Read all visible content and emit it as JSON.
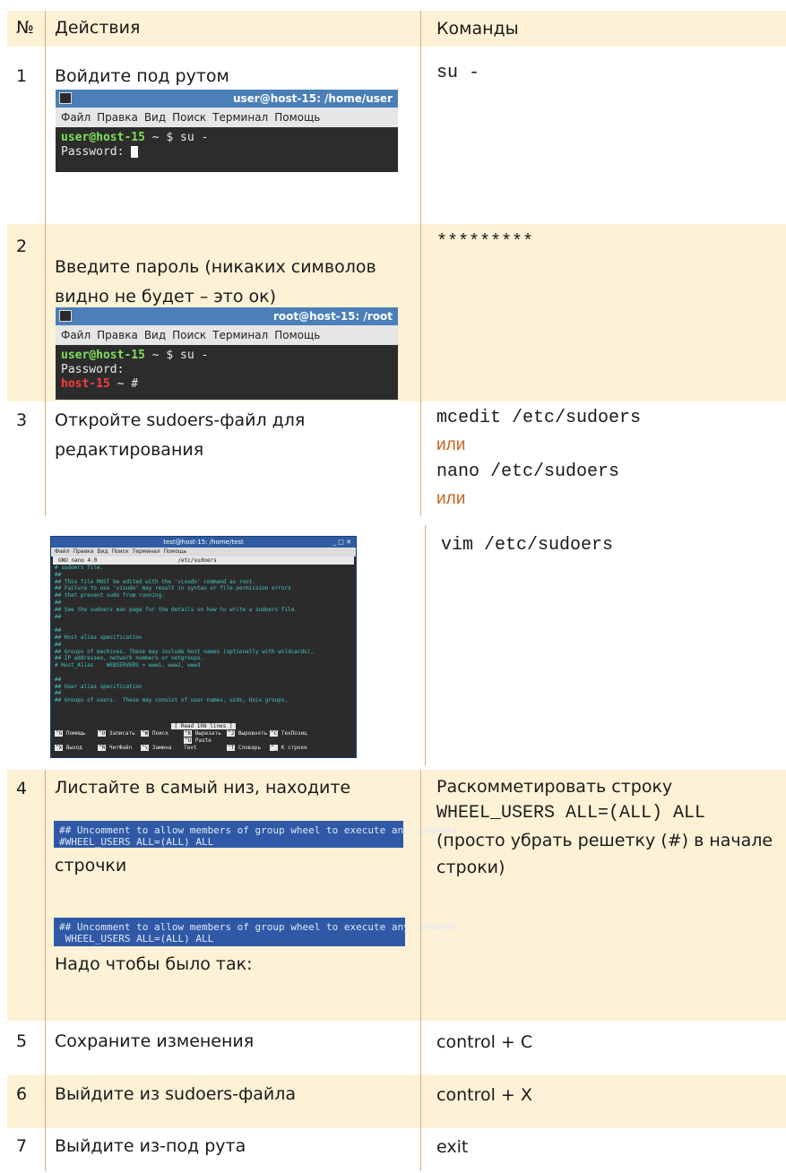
{
  "header": {
    "num": "№",
    "actions": "Действия",
    "commands": "Команды"
  },
  "rows": [
    {
      "num": "1",
      "action": "Войдите под рутом",
      "command": "su -",
      "terminal": {
        "title": "user@host-15: /home/user",
        "menu": [
          "Файл",
          "Правка",
          "Вид",
          "Поиск",
          "Терминал",
          "Помощь"
        ],
        "prompt_user": "user@host-15",
        "prompt_rest": " ~ $ su -",
        "line2": "Password: "
      }
    },
    {
      "num": "2",
      "action": "Введите пароль (никаких символов видно не будет – это ок)",
      "command": "*********",
      "terminal": {
        "title": "root@host-15: /root",
        "menu": [
          "Файл",
          "Правка",
          "Вид",
          "Поиск",
          "Терминал",
          "Помощь"
        ],
        "prompt_user": "user@host-15",
        "prompt_rest": " ~ $ su -",
        "line2": "Password:",
        "root_host": "host-15",
        "root_rest": " ~ #"
      }
    },
    {
      "num": "3",
      "action": "Откройте sudoers-файл для редактирования",
      "cmd1": "mcedit /etc/sudoers",
      "or1": "или",
      "cmd2": "nano /etc/sudoers",
      "or2": "или"
    },
    {
      "cmd3": "vim /etc/sudoers",
      "nano": {
        "title": "test@host-15: /home/test",
        "controls": "_ □ ✕",
        "menu": [
          "Файл",
          "Правка",
          "Вид",
          "Поиск",
          "Терминал",
          "Помощь"
        ],
        "hdr_left": "GNU nano 4.0",
        "hdr_file": "/etc/sudoers",
        "lines": [
          "# sudoers file.",
          "##",
          "## This file MUST be edited with the 'visudo' command as root.",
          "## Failure to use 'visudo' may result in syntax or file permission errors",
          "## that prevent sudo from running.",
          "##",
          "## See the sudoers man page for the details on how to write a sudoers file.",
          "##",
          "",
          "##",
          "## Host alias specification",
          "##",
          "## Groups of machines. These may include host names (optionally with wildcards),",
          "## IP addresses, network numbers or netgroups.",
          "# Host_Alias    WEBSERVERS = www1, www2, www3",
          "",
          "##",
          "## User alias specification",
          "##",
          "## Groups of users.  These may consist of user names, uids, Unix groups,"
        ],
        "status": "[ Read 108 lines ]",
        "keys1": [
          [
            "^G",
            "Помощь"
          ],
          [
            "^O",
            "Записать"
          ],
          [
            "^W",
            "Поиск"
          ],
          [
            "^K",
            "Вырезать"
          ],
          [
            "^J",
            "Выровнять"
          ],
          [
            "^C",
            "ТекПозиц"
          ]
        ],
        "keys2": [
          [
            "^X",
            "Выход"
          ],
          [
            "^R",
            "ЧитФайл"
          ],
          [
            "^\\",
            "Замена"
          ],
          [
            "^U",
            "Paste Text"
          ],
          [
            "^T",
            "Словарь"
          ],
          [
            "^_",
            "К строке"
          ]
        ]
      }
    },
    {
      "num": "4",
      "action1": "Листайте в самый низ, находите",
      "box1_l1": "## Uncomment to allow members of group wheel to execute any command",
      "box1_l2": "#WHEEL_USERS ALL=(ALL) ALL",
      "action2": "строчки",
      "box2_l1": "## Uncomment to allow members of group wheel to execute any command",
      "box2_l2": " WHEEL_USERS ALL=(ALL) ALL",
      "action3": "Надо чтобы было так:",
      "cmd_a": "Раскомметировать строку",
      "cmd_b": "WHEEL_USERS ALL=(ALL) ALL",
      "cmd_c": "(просто убрать решетку (#) в начале строки)"
    },
    {
      "num": "5",
      "action": "Сохраните изменения",
      "command": "control + C"
    },
    {
      "num": "6",
      "action": "Выйдите из sudoers-файла",
      "command": "control + X"
    },
    {
      "num": "7",
      "action": "Выйдите из-под рута",
      "command": "exit"
    }
  ]
}
